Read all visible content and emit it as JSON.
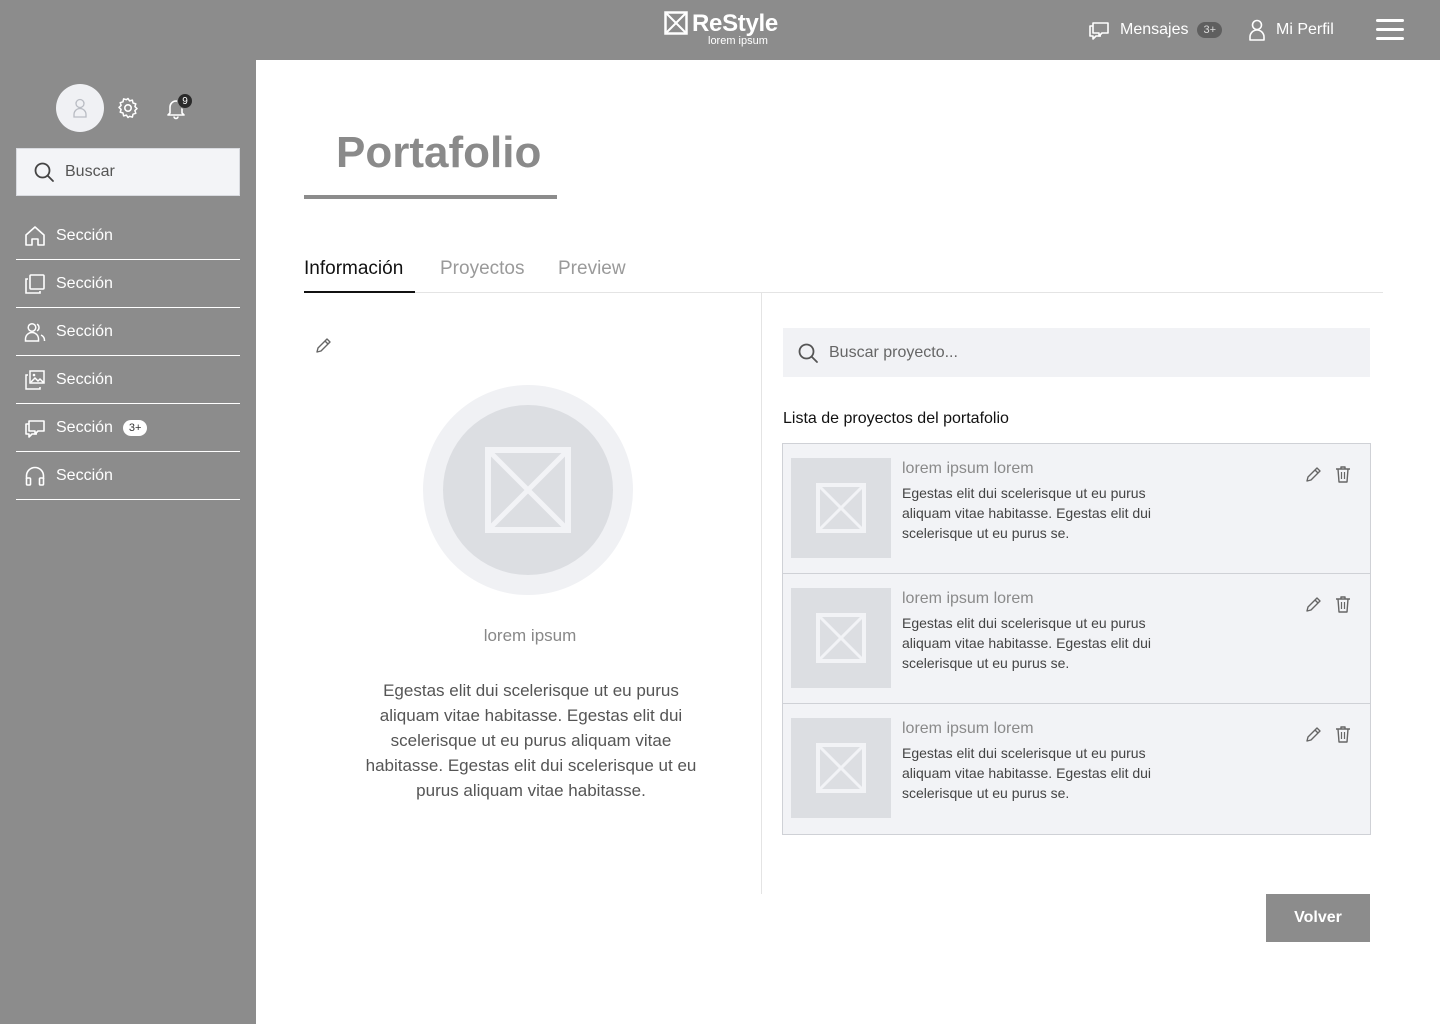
{
  "header": {
    "brand_title": "ReStyle",
    "brand_subtitle": "lorem ipsum",
    "messages_label": "Mensajes",
    "messages_badge": "3+",
    "profile_label": "Mi Perfil"
  },
  "sidebar": {
    "notifications_count": "9",
    "search_placeholder": "Buscar",
    "items": [
      {
        "label": "Sección",
        "icon": "home-icon"
      },
      {
        "label": "Sección",
        "icon": "copy-icon"
      },
      {
        "label": "Sección",
        "icon": "users-icon"
      },
      {
        "label": "Sección",
        "icon": "images-icon"
      },
      {
        "label": "Sección",
        "icon": "chat-icon",
        "badge": "3+"
      },
      {
        "label": "Sección",
        "icon": "headphones-icon"
      }
    ]
  },
  "main": {
    "title": "Portafolio",
    "tabs": [
      {
        "label": "Información",
        "active": true
      },
      {
        "label": "Proyectos",
        "active": false
      },
      {
        "label": "Preview",
        "active": false
      }
    ],
    "profile": {
      "caption": "lorem ipsum",
      "description": "Egestas elit dui scelerisque ut eu purus aliquam vitae habitasse. Egestas elit dui scelerisque ut eu purus aliquam vitae habitasse.  Egestas elit dui scelerisque ut eu purus aliquam vitae habitasse."
    },
    "projects": {
      "search_placeholder": "Buscar proyecto...",
      "list_title": "Lista de proyectos del portafolio",
      "items": [
        {
          "name": "lorem ipsum lorem",
          "description": "Egestas elit dui scelerisque ut eu purus aliquam vitae habitasse. Egestas elit dui scelerisque ut eu purus se."
        },
        {
          "name": "lorem ipsum lorem",
          "description": "Egestas elit dui scelerisque ut eu purus aliquam vitae habitasse. Egestas elit dui scelerisque ut eu purus se."
        },
        {
          "name": "lorem ipsum lorem",
          "description": "Egestas elit dui scelerisque ut eu purus aliquam vitae habitasse. Egestas elit dui scelerisque ut eu purus se."
        }
      ]
    },
    "back_button": "Volver"
  },
  "colors": {
    "chrome": "#8c8c8c",
    "panel": "#f2f3f6",
    "placeholder": "#dcdee2"
  }
}
